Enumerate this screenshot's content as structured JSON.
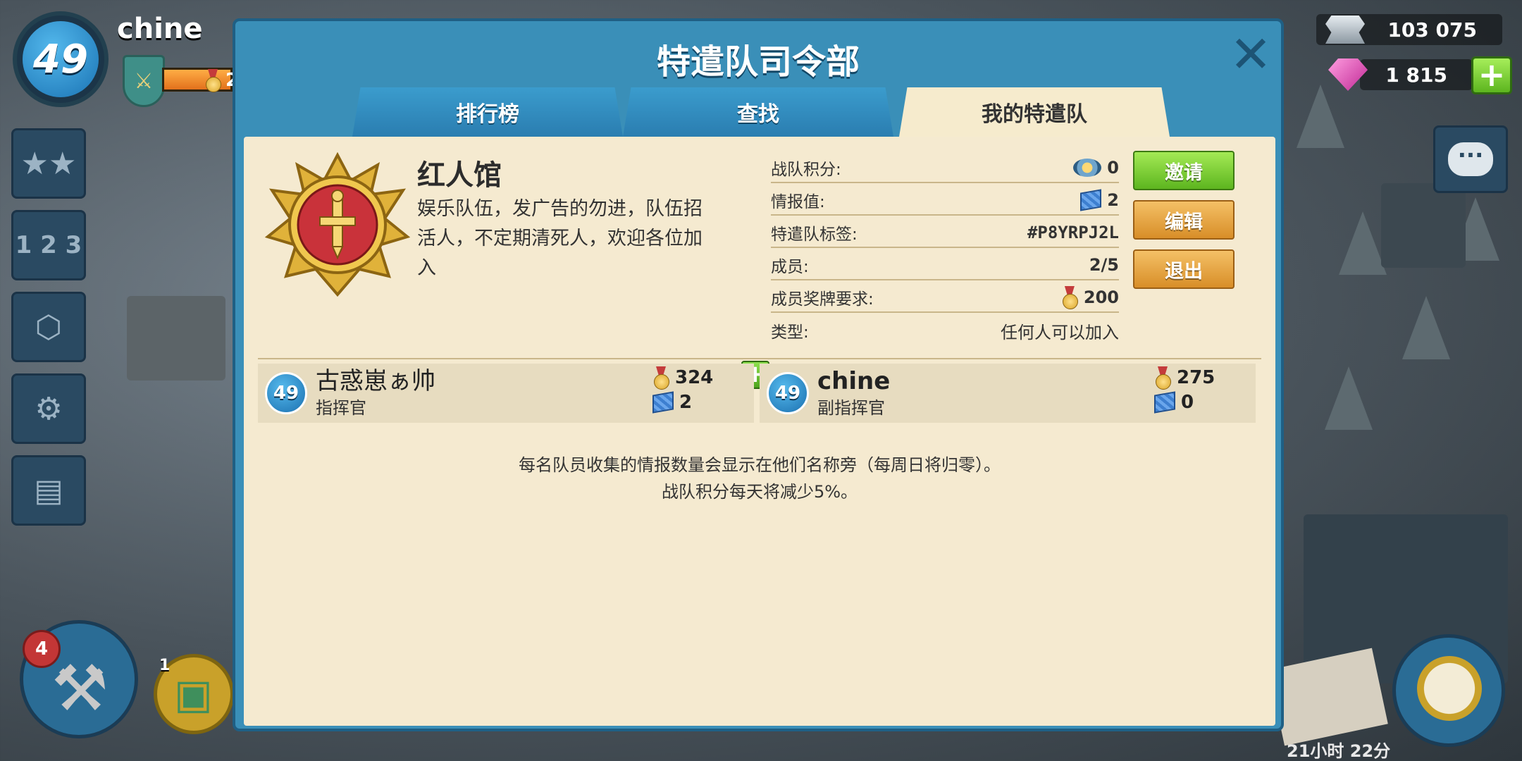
{
  "hud": {
    "player_level": "49",
    "player_name": "chine",
    "medal_count_partial": "2",
    "iron": "103 075",
    "diamonds": "1 815",
    "builder_count": "4",
    "gift_count": "1",
    "timer": "21小时 22分"
  },
  "modal": {
    "title": "特遣队司令部",
    "tabs": [
      {
        "label": "排行榜"
      },
      {
        "label": "查找"
      },
      {
        "label": "我的特遣队"
      }
    ],
    "clan": {
      "name": "红人馆",
      "description": "娱乐队伍，发广告的勿进，队伍招活人，不定期清死人，欢迎各位加入"
    },
    "info": {
      "score_label": "战队积分:",
      "score_value": "0",
      "intel_label": "情报值:",
      "intel_value": "2",
      "tag_label": "特遣队标签:",
      "tag_value": "#P8YRPJ2L",
      "members_label": "成员:",
      "members_value": "2/5",
      "medal_req_label": "成员奖牌要求:",
      "medal_req_value": "200",
      "type_label": "类型:",
      "type_value": "任何人可以加入"
    },
    "buttons": {
      "invite": "邀请",
      "edit": "编辑",
      "leave": "退出"
    },
    "members": [
      {
        "level": "49",
        "name": "古惑崽ぁ帅",
        "role": "指挥官",
        "medals": "324",
        "intel": "2"
      },
      {
        "level": "49",
        "name": "chine",
        "role": "副指挥官",
        "medals": "275",
        "intel": "0"
      }
    ],
    "notes": {
      "line1": "每名队员收集的情报数量会显示在他们名称旁（每周日将归零）。",
      "line2": "战队积分每天将减少5%。"
    }
  },
  "colors": {
    "modal_frame": "#3a8fb8",
    "panel": "#f5ead0",
    "green_button": "#5db51f",
    "orange_button": "#d88e28"
  }
}
